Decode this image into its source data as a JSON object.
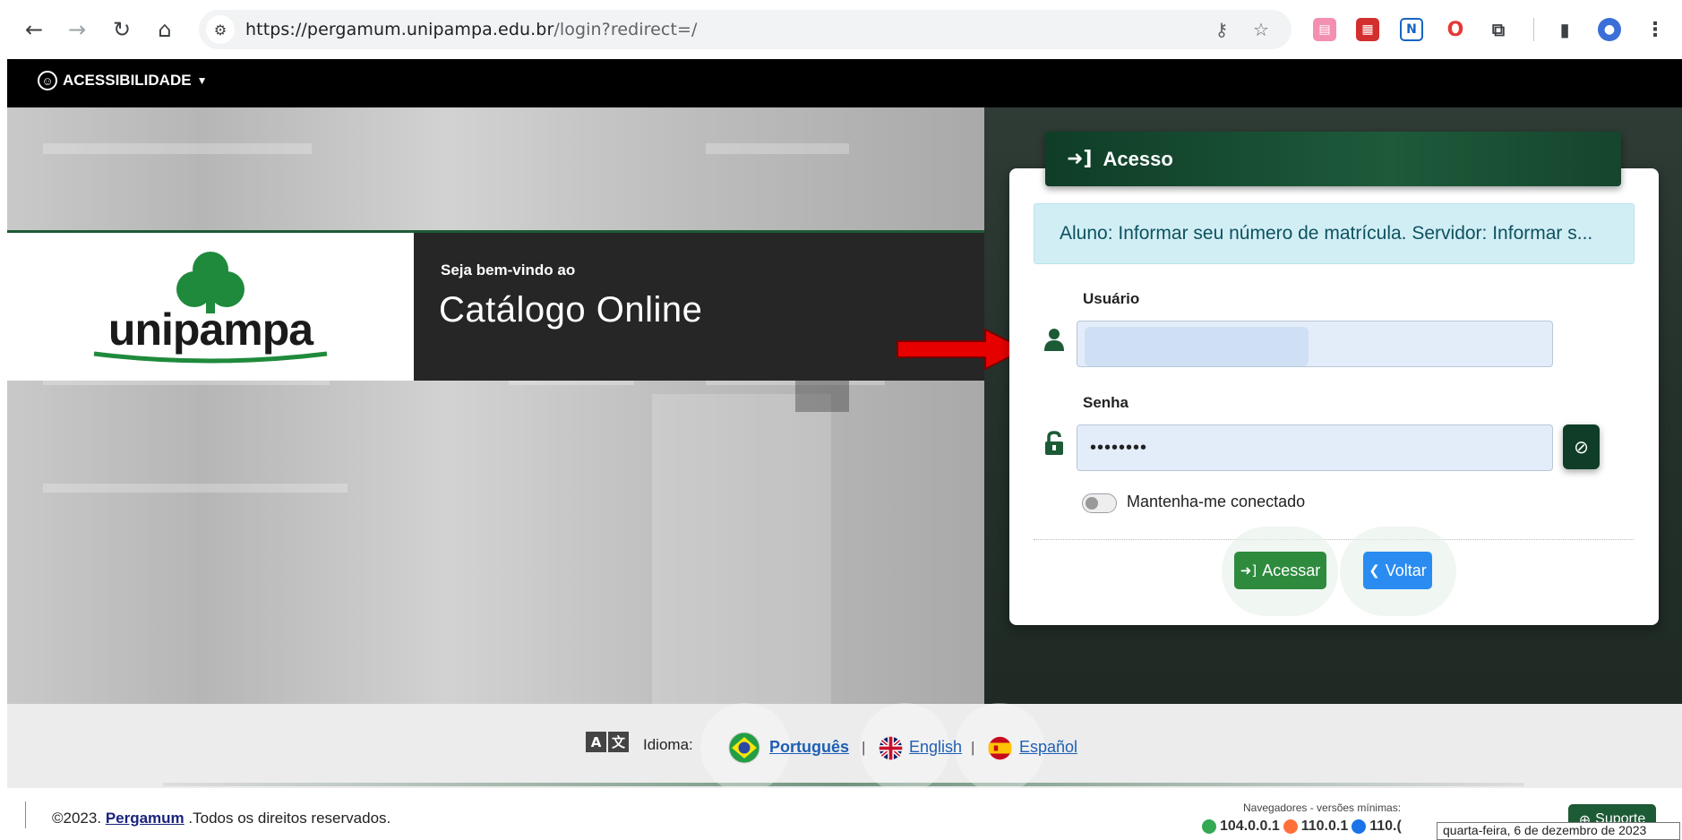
{
  "browser": {
    "url_host": "https://pergamum.unipampa.edu.br",
    "url_path": "/login?redirect=/"
  },
  "site": {
    "accessibility_label": "ACESSIBILIDADE"
  },
  "hero": {
    "logo_text": "unipampa",
    "welcome": "Seja bem-vindo ao",
    "title": "Catálogo Online"
  },
  "login": {
    "header": "Acesso",
    "alert": "Aluno: Informar seu número de matrícula. Servidor: Informar s...",
    "username_label": "Usuário",
    "username_value": "",
    "password_label": "Senha",
    "password_value": "••••••••",
    "remember_label": "Mantenha-me conectado",
    "remember_checked": false,
    "submit_label": "Acessar",
    "back_label": "Voltar"
  },
  "language": {
    "label": "Idioma:",
    "options": [
      "Português",
      "English",
      "Español"
    ],
    "selected": "Português"
  },
  "footer": {
    "copyright_prefix": "©2023.",
    "copyright_link": "Pergamum",
    "copyright_suffix": ".Todos os direitos reservados.",
    "browsers_title": "Navegadores - versões mínimas:",
    "browser_versions": [
      "104.0.0.1",
      "110.0.1",
      "110.("
    ],
    "support_label": "Suporte",
    "date_tooltip": "quarta-feira, 6 de dezembro de 2023"
  },
  "colors": {
    "brand_green": "#1d5a36",
    "header_green": "#0f3d27",
    "submit_green": "#2e8b3e",
    "back_blue": "#2a8cf0",
    "alert_bg": "#d2eef5",
    "arrow_red": "#e60000"
  }
}
